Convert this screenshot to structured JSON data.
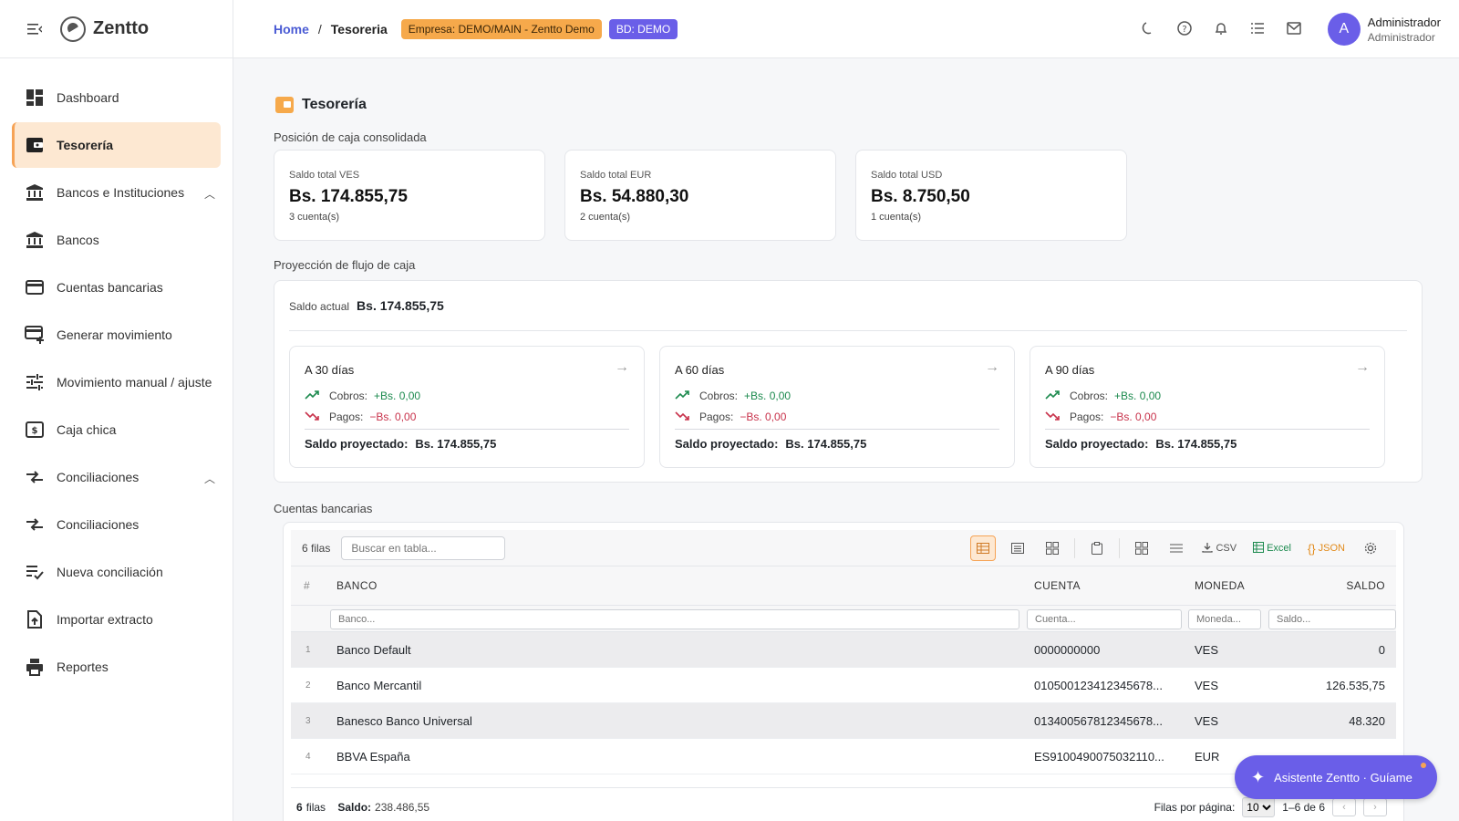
{
  "brand": {
    "name": "Zentto"
  },
  "sidebar": {
    "items": [
      {
        "label": "Dashboard",
        "icon": "dashboard-icon"
      },
      {
        "label": "Tesorería",
        "icon": "wallet-icon",
        "active": true
      },
      {
        "label": "Bancos e Instituciones",
        "icon": "bank-icon",
        "expanded": true
      },
      {
        "label": "Bancos",
        "icon": "bank-icon"
      },
      {
        "label": "Cuentas bancarias",
        "icon": "credit-card-icon"
      },
      {
        "label": "Generar movimiento",
        "icon": "card-add-icon"
      },
      {
        "label": "Movimiento manual / ajuste",
        "icon": "tune-icon"
      },
      {
        "label": "Caja chica",
        "icon": "cash-icon"
      },
      {
        "label": "Conciliaciones",
        "icon": "compare-icon",
        "expanded": true
      },
      {
        "label": "Conciliaciones",
        "icon": "compare-icon"
      },
      {
        "label": "Nueva conciliación",
        "icon": "playlist-check-icon"
      },
      {
        "label": "Importar extracto",
        "icon": "file-upload-icon"
      },
      {
        "label": "Reportes",
        "icon": "printer-icon"
      }
    ]
  },
  "topbar": {
    "breadcrumb": {
      "home": "Home",
      "sep": "/",
      "current": "Tesoreria"
    },
    "empresa_chip": "Empresa: DEMO/MAIN - Zentto Demo",
    "bd_chip": "BD: DEMO",
    "icons": [
      "moon-icon",
      "help-icon",
      "bell-icon",
      "list-icon",
      "mail-icon"
    ],
    "user": {
      "initial": "A",
      "name": "Administrador",
      "role": "Administrador"
    }
  },
  "page": {
    "title": "Tesorería",
    "position_label": "Posición de caja consolidada",
    "summary": [
      {
        "label": "Saldo total VES",
        "amount": "Bs. 174.855,75",
        "sub": "3 cuenta(s)"
      },
      {
        "label": "Saldo total EUR",
        "amount": "Bs. 54.880,30",
        "sub": "2 cuenta(s)"
      },
      {
        "label": "Saldo total USD",
        "amount": "Bs. 8.750,50",
        "sub": "1 cuenta(s)"
      }
    ],
    "projection_label": "Proyección de flujo de caja",
    "projection": {
      "saldo_label": "Saldo actual",
      "saldo_value": "Bs. 174.855,75",
      "periods": [
        {
          "title": "A 30 días",
          "cobros_label": "Cobros:",
          "cobros": "+Bs. 0,00",
          "pagos_label": "Pagos:",
          "pagos": "−Bs. 0,00",
          "total_label": "Saldo proyectado:",
          "total": "Bs. 174.855,75"
        },
        {
          "title": "A 60 días",
          "cobros_label": "Cobros:",
          "cobros": "+Bs. 0,00",
          "pagos_label": "Pagos:",
          "pagos": "−Bs. 0,00",
          "total_label": "Saldo proyectado:",
          "total": "Bs. 174.855,75"
        },
        {
          "title": "A 90 días",
          "cobros_label": "Cobros:",
          "cobros": "+Bs. 0,00",
          "pagos_label": "Pagos:",
          "pagos": "−Bs. 0,00",
          "total_label": "Saldo proyectado:",
          "total": "Bs. 174.855,75"
        }
      ]
    },
    "accounts_label": "Cuentas bancarias"
  },
  "table": {
    "row_count": "6 filas",
    "search_placeholder": "Buscar en tabla...",
    "tools": {
      "csv": "CSV",
      "excel": "Excel",
      "json": "JSON"
    },
    "columns": {
      "num": "#",
      "banco": "BANCO",
      "cuenta": "CUENTA",
      "moneda": "MONEDA",
      "saldo": "SALDO"
    },
    "filters": {
      "banco": "Banco...",
      "cuenta": "Cuenta...",
      "moneda": "Moneda...",
      "saldo": "Saldo..."
    },
    "rows": [
      {
        "n": "1",
        "banco": "Banco Default",
        "cuenta": "0000000000",
        "moneda": "VES",
        "saldo": "0"
      },
      {
        "n": "2",
        "banco": "Banco Mercantil",
        "cuenta": "010500123412345678...",
        "moneda": "VES",
        "saldo": "126.535,75"
      },
      {
        "n": "3",
        "banco": "Banesco Banco Universal",
        "cuenta": "013400567812345678...",
        "moneda": "VES",
        "saldo": "48.320"
      },
      {
        "n": "4",
        "banco": "BBVA España",
        "cuenta": "ES9100490075032110...",
        "moneda": "EUR",
        "saldo": ""
      }
    ],
    "footer": {
      "rows_bold": "6",
      "rows_text": "filas",
      "saldo_label": "Saldo:",
      "saldo_value": "238.486,55",
      "per_page_label": "Filas por página:",
      "per_page_value": "10",
      "range": "1–6 de 6",
      "prev": "‹",
      "next": "›"
    }
  },
  "assistant": {
    "label": "Asistente Zentto · Guíame"
  },
  "colors": {
    "accent": "#f6a356",
    "brand": "#6a5ee8",
    "positive": "#1c8a4e",
    "negative": "#c8324b"
  }
}
